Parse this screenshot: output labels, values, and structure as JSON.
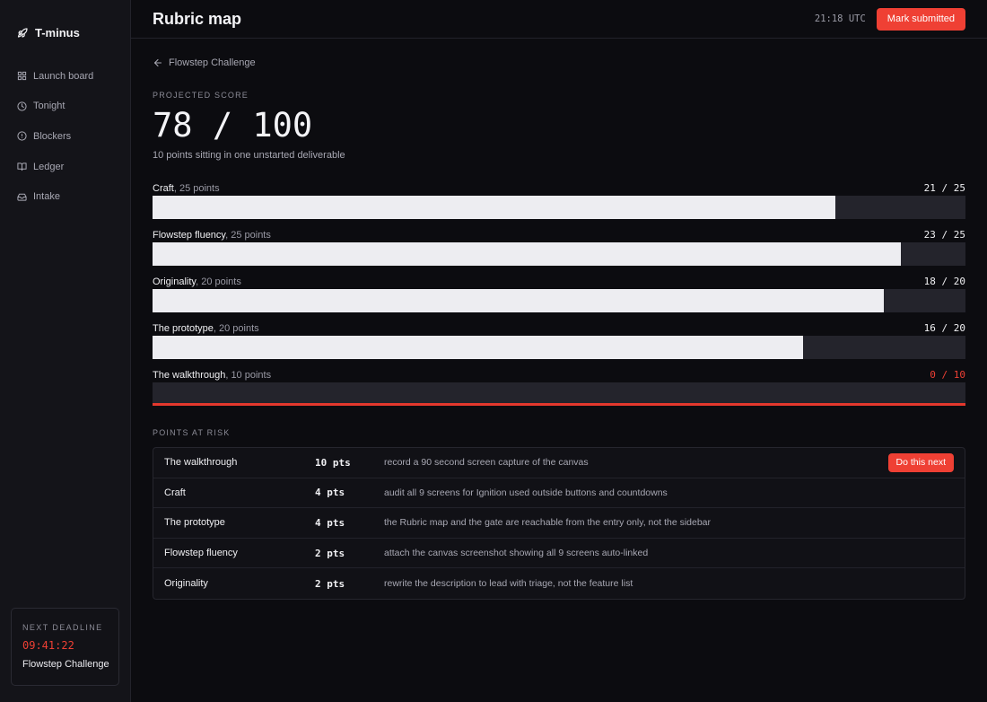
{
  "app": {
    "name": "T-minus"
  },
  "sidebar": {
    "items": [
      {
        "label": "Launch board",
        "icon": "grid-icon"
      },
      {
        "label": "Tonight",
        "icon": "clock-icon"
      },
      {
        "label": "Blockers",
        "icon": "alert-circle-icon"
      },
      {
        "label": "Ledger",
        "icon": "book-icon"
      },
      {
        "label": "Intake",
        "icon": "inbox-icon"
      }
    ],
    "deadline": {
      "caption": "NEXT DEADLINE",
      "time": "09:41:22",
      "name": "Flowstep Challenge"
    }
  },
  "header": {
    "title": "Rubric map",
    "clock": "21:18 UTC",
    "primary_action": "Mark submitted"
  },
  "back_link": "Flowstep Challenge",
  "score": {
    "caption": "PROJECTED SCORE",
    "value": "78 / 100",
    "subtitle": "10 points sitting in one unstarted deliverable"
  },
  "criteria": [
    {
      "name": "Craft",
      "points": ", 25 points",
      "score": "21 / 25",
      "earned": 21,
      "max": 25
    },
    {
      "name": "Flowstep fluency",
      "points": ", 25 points",
      "score": "23 / 25",
      "earned": 23,
      "max": 25
    },
    {
      "name": "Originality",
      "points": ", 20 points",
      "score": "18 / 20",
      "earned": 18,
      "max": 20
    },
    {
      "name": "The prototype",
      "points": ", 20 points",
      "score": "16 / 20",
      "earned": 16,
      "max": 20
    },
    {
      "name": "The walkthrough",
      "points": ", 10 points",
      "score": "0 / 10",
      "earned": 0,
      "max": 10
    }
  ],
  "risk": {
    "caption": "POINTS AT RISK",
    "rows": [
      {
        "name": "The walkthrough",
        "pts": "10 pts",
        "action": "record a 90 second screen capture of the canvas",
        "cta": "Do this next"
      },
      {
        "name": "Craft",
        "pts": "4 pts",
        "action": "audit all 9 screens for Ignition used outside buttons and countdowns"
      },
      {
        "name": "The prototype",
        "pts": "4 pts",
        "action": "the Rubric map and the gate are reachable from the entry only, not the sidebar"
      },
      {
        "name": "Flowstep fluency",
        "pts": "2 pts",
        "action": "attach the canvas screenshot showing all 9 screens auto-linked"
      },
      {
        "name": "Originality",
        "pts": "2 pts",
        "action": "rewrite the description to lead with triage, not the feature list"
      }
    ]
  },
  "colors": {
    "accent": "#ef4034",
    "background": "#0c0c10",
    "sidebar": "#141419",
    "bar_fill": "#ededf1",
    "bar_track": "#24242c"
  }
}
